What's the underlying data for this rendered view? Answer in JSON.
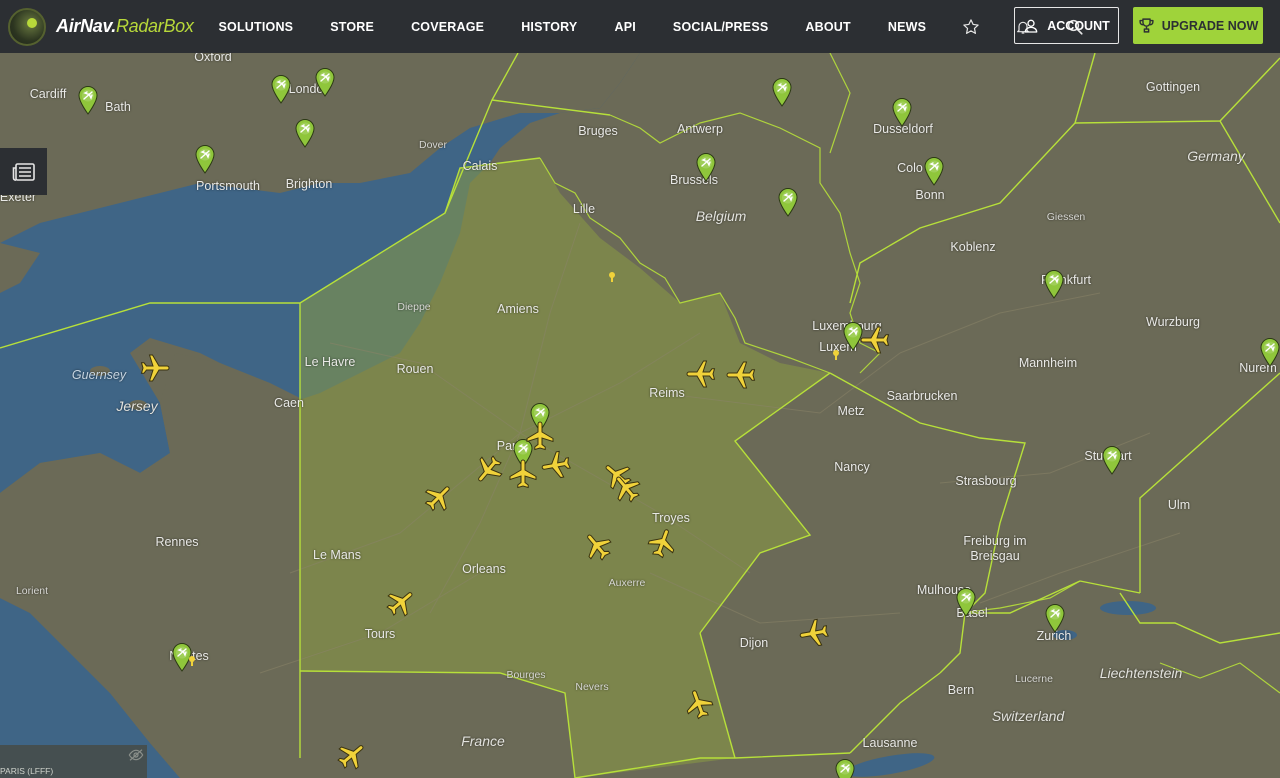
{
  "header": {
    "logo": {
      "part1": "AirNav.",
      "part2": "RadarBox"
    },
    "nav": [
      "SOLUTIONS",
      "STORE",
      "COVERAGE",
      "HISTORY",
      "API",
      "SOCIAL/PRESS",
      "ABOUT",
      "NEWS"
    ],
    "icons": [
      "star-icon",
      "bell-icon",
      "search-icon"
    ],
    "account_label": "ACCOUNT",
    "upgrade_label": "UPGRADE NOW"
  },
  "colors": {
    "header_bg": "#2c2f33",
    "accent_green": "#9fd33a",
    "border_line": "#b7e03a",
    "sea": "#3f6586",
    "land": "#6b6a57",
    "highlight_fill": "#8a9a44",
    "plane_yellow": "#f0d23a",
    "pin_green": "#8fc63b"
  },
  "map": {
    "sea_labels": [
      "Guernsey",
      "Jersey"
    ],
    "region_labels": [
      "Belgium",
      "Germany",
      "France",
      "Switzerland",
      "Liechtenstein"
    ],
    "cities": [
      "Oxford",
      "Cardiff",
      "Bath",
      "Londo",
      "Dover",
      "Portsmouth",
      "Brighton",
      "Exeter",
      "Calais",
      "Bruges",
      "Antwerp",
      "Brussels",
      "Lille",
      "Dusseldorf",
      "Colo",
      "Bonn",
      "Gottingen",
      "Koblenz",
      "Frankfurt",
      "Wurzburg",
      "Mannheim",
      "Nurem",
      "Luxembourg",
      "Luxem",
      "Saarbrucken",
      "Metz",
      "Nancy",
      "Strasbourg",
      "Stuttgart",
      "Ulm",
      "Freiburg im Breisgau",
      "Mulhouse",
      "Basel",
      "Zurich",
      "Lucerne",
      "Bern",
      "Lausanne",
      "Dijon",
      "Troyes",
      "Reims",
      "Amiens",
      "Dieppe",
      "Le Havre",
      "Rouen",
      "Caen",
      "Paris",
      "Rennes",
      "Le Mans",
      "Orleans",
      "Tours",
      "Nantes",
      "Lorient",
      "Auxerre",
      "Bourges",
      "Nevers",
      "Giessen"
    ],
    "planes_count_label": "",
    "airspace_label": "PARIS (LFFF)"
  }
}
